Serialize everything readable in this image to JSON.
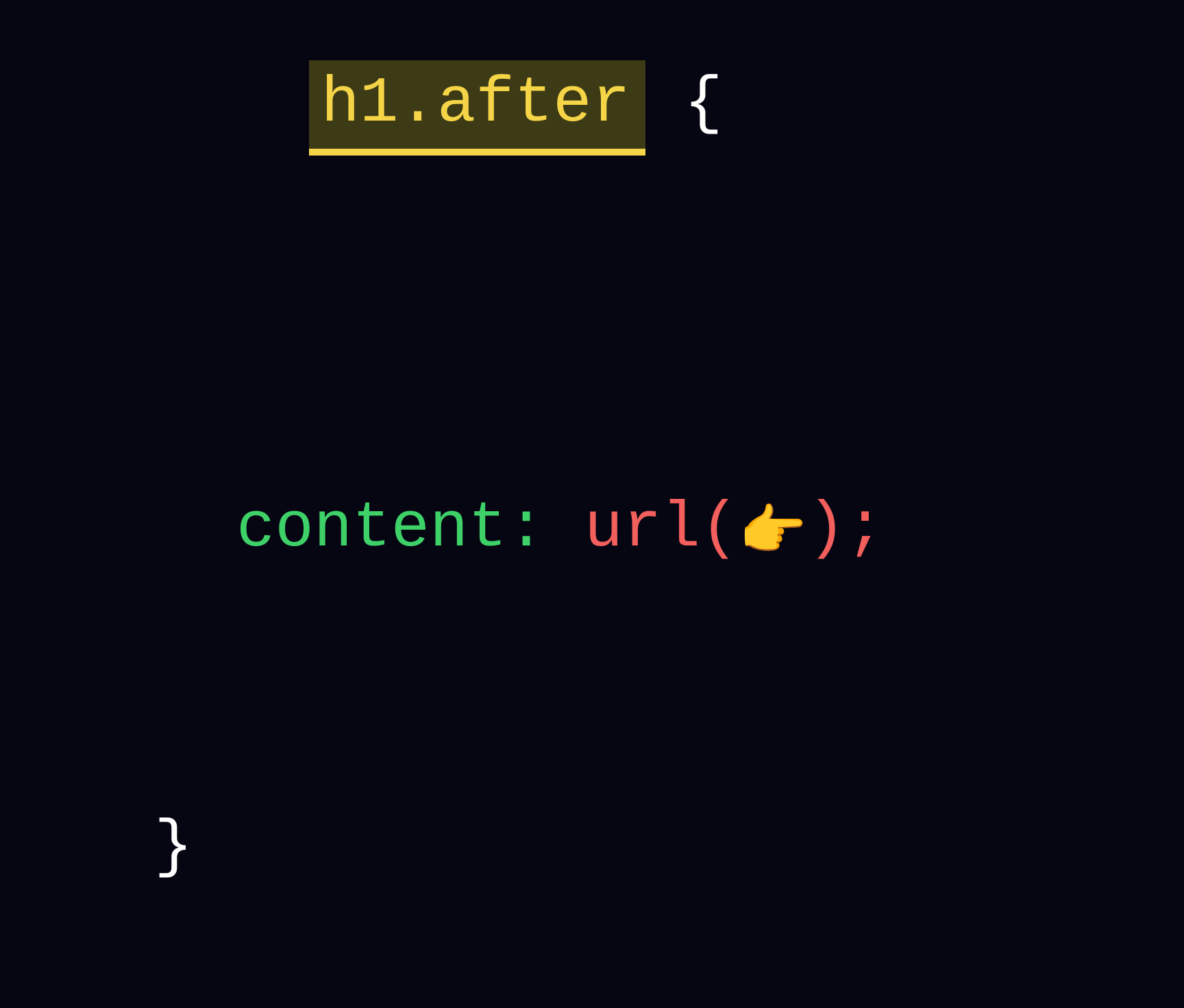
{
  "code": {
    "selector": "h1.after",
    "open_brace": "{",
    "property": "content:",
    "value_func": "url(",
    "emoji": "👉",
    "value_close": ")",
    "semicolon": ";",
    "close_brace": "}"
  },
  "colors": {
    "background": "#060613",
    "selector_text": "#f5d547",
    "selector_bg": "#3d3a16",
    "selector_underline": "#f5d547",
    "brace": "#ffffff",
    "property": "#3dd168",
    "value": "#f25f5c"
  }
}
